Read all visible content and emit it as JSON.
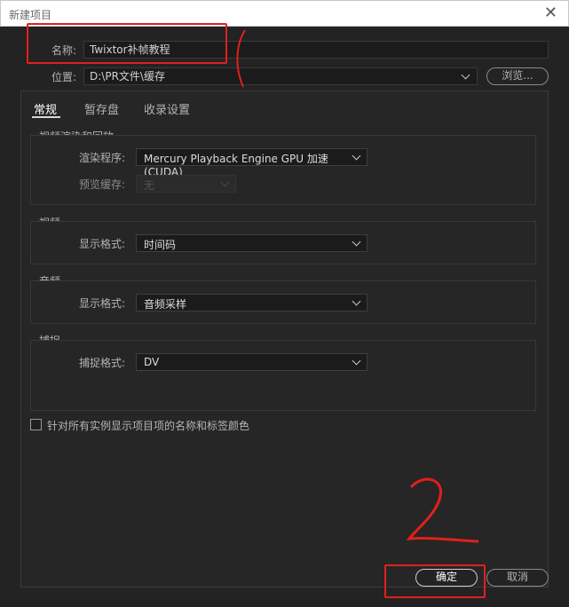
{
  "window": {
    "title": "新建项目",
    "close_glyph": "✕"
  },
  "name_row": {
    "label": "名称:",
    "value": "Twixtor补帧教程"
  },
  "location_row": {
    "label": "位置:",
    "value": "D:\\PR文件\\缓存",
    "browse_label": "浏览..."
  },
  "tabs": [
    {
      "label": "常规",
      "active": true
    },
    {
      "label": "暂存盘",
      "active": false
    },
    {
      "label": "收录设置",
      "active": false
    }
  ],
  "groups": {
    "render": {
      "title": "视频渲染和回放",
      "renderer_label": "渲染程序:",
      "renderer_value": "Mercury Playback Engine GPU 加速 (CUDA)",
      "preview_cache_label": "预览缓存:",
      "preview_cache_value": "无"
    },
    "video": {
      "title": "视频",
      "format_label": "显示格式:",
      "format_value": "时间码"
    },
    "audio": {
      "title": "音频",
      "format_label": "显示格式:",
      "format_value": "音频采样"
    },
    "capture": {
      "title": "捕捉",
      "format_label": "捕捉格式:",
      "format_value": "DV"
    }
  },
  "checkbox": {
    "label": "针对所有实例显示项目项的名称和标签颜色",
    "checked": false
  },
  "footer": {
    "ok_label": "确定",
    "cancel_label": "取消"
  },
  "annotations": {
    "mark_one": "(",
    "mark_two": "2",
    "color": "#e0201c"
  },
  "colors": {
    "background": "#232323",
    "accent_annotation": "#e0201c"
  }
}
